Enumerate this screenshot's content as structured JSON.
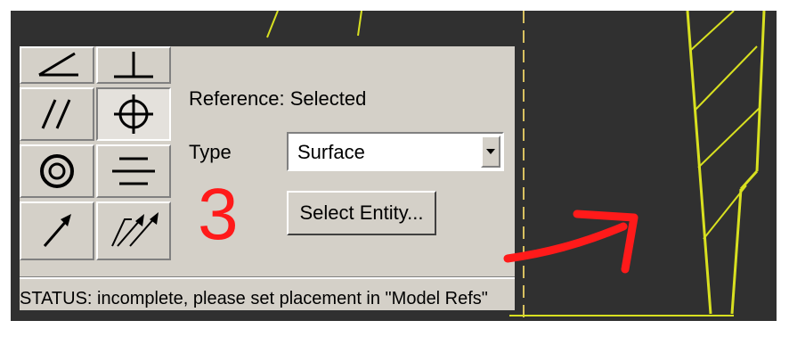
{
  "dashboard": {
    "tools": [
      {
        "name": "angle-icon"
      },
      {
        "name": "perpendicular-icon"
      },
      {
        "name": "parallel-icon"
      },
      {
        "name": "coaxial-icon"
      },
      {
        "name": "concentric-icon"
      },
      {
        "name": "align-icon"
      },
      {
        "name": "tangent-arrow-icon"
      },
      {
        "name": "double-arrow-icon"
      }
    ],
    "reference_label": "Reference: Selected",
    "type_label": "Type",
    "type_value": "Surface",
    "select_entity_label": "Select Entity...",
    "step_number": "3",
    "status_text": "STATUS: incomplete, please set placement in \"Model Refs\""
  },
  "colors": {
    "viewport_bg": "#303030",
    "geometry": "#d8e020",
    "annotation": "#ff1a1a",
    "panel_bg": "#d4d0c8"
  }
}
